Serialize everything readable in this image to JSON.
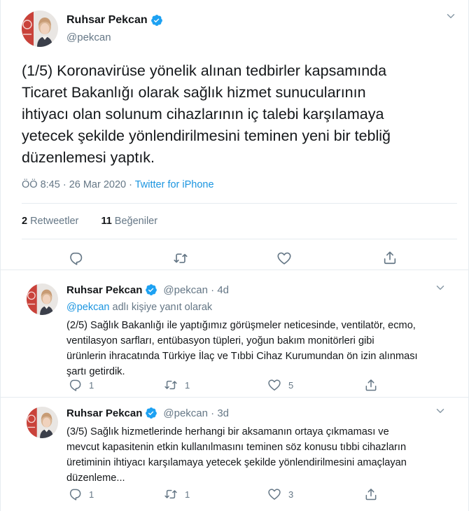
{
  "main_tweet": {
    "author_name": "Ruhsar Pekcan",
    "handle": "@pekcan",
    "text": "(1/5) Koronavirüse yönelik alınan tedbirler kapsamında\nTicaret Bakanlığı olarak sağlık hizmet sunucularının\nihtiyacı olan solunum cihazlarının iç talebi karşılamaya\nyetecek şekilde yönlendirilmesini teminen yeni bir tebliğ\ndüzenlemesi yaptık.",
    "time": "ÖÖ 8:45 · 26 Mar 2020 · ",
    "source": "Twitter for iPhone",
    "retweet_count": "2",
    "retweet_label": "Retweetler",
    "like_count": "11",
    "like_label": "Beğeniler"
  },
  "replies": [
    {
      "author_name": "Ruhsar Pekcan",
      "meta": "@pekcan · 4d",
      "reply_handle": "@pekcan",
      "reply_suffix": " adlı kişiye yanıt olarak",
      "text": "(2/5) Sağlık Bakanlığı ile yaptığımız görüşmeler neticesinde,  ventilatör, ecmo,\nventilasyon sarfları, entübasyon tüpleri, yoğun bakım monitörleri gibi\nürünlerin ihracatında Türkiye İlaç ve Tıbbi Cihaz Kurumundan ön izin alınması\nşartı getirdik.",
      "reply_count": "1",
      "retweet_count": "1",
      "like_count": "5"
    },
    {
      "author_name": "Ruhsar Pekcan",
      "meta": "@pekcan · 3d",
      "text": "(3/5) Sağlık hizmetlerinde herhangi bir aksamanın ortaya çıkmaması ve\nmevcut kapasitenin etkin kullanılmasını teminen söz konusu tıbbi cihazların\nüretiminin ihtiyacı karşılamaya yetecek şekilde yönlendirilmesini amaçlayan\ndüzenleme...",
      "reply_count": "1",
      "retweet_count": "1",
      "like_count": "3"
    }
  ],
  "icons": {
    "verified": "verified-badge-icon",
    "reply": "reply-icon",
    "retweet": "retweet-icon",
    "like": "heart-icon",
    "share": "share-icon",
    "more": "chevron-down-icon"
  },
  "colors": {
    "accent": "#1da1f2",
    "link": "#1b95e0",
    "muted": "#657786",
    "text": "#14171a",
    "border": "#e6ecf0"
  }
}
